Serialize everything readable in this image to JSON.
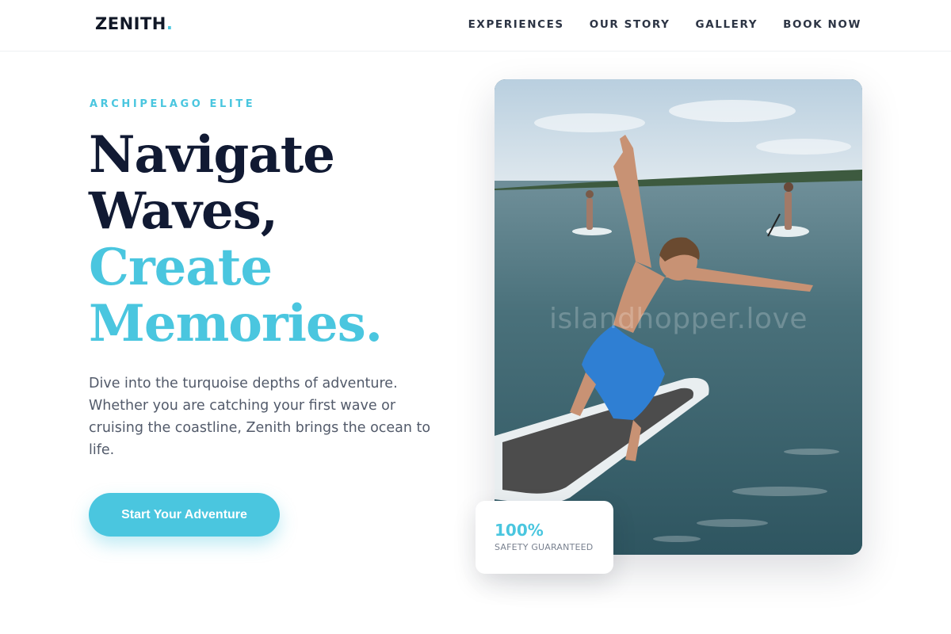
{
  "header": {
    "logo_text": "ZENITH",
    "logo_dot": ".",
    "nav": [
      {
        "label": "EXPERIENCES"
      },
      {
        "label": "OUR STORY"
      },
      {
        "label": "GALLERY"
      },
      {
        "label": "BOOK NOW"
      }
    ]
  },
  "hero": {
    "eyebrow": "ARCHIPELAGO ELITE",
    "headline_line1": "Navigate",
    "headline_line2": "Waves,",
    "headline_line3": "Create",
    "headline_line4": "Memories.",
    "lead": "Dive into the turquoise depths of adventure. Whether you are catching your first wave or cruising the coastline, Zenith brings the ocean to life.",
    "cta_label": "Start Your Adventure",
    "image_watermark": "islandhopper.love"
  },
  "stat_card": {
    "value": "100%",
    "label": "SAFETY GUARANTEED"
  },
  "colors": {
    "accent": "#4ac6df",
    "heading": "#111a33",
    "body_text": "#525a6a"
  }
}
